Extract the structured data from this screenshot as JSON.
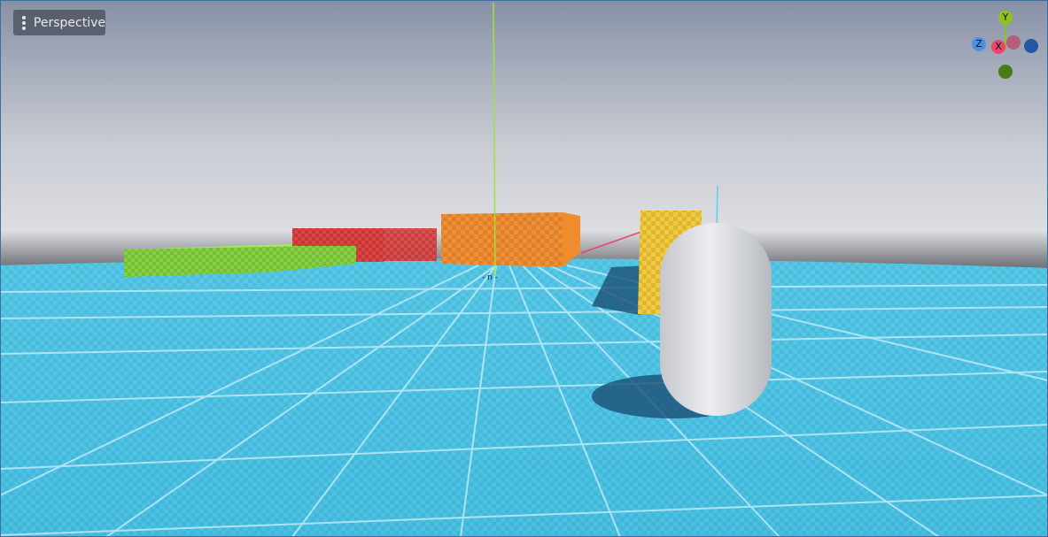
{
  "viewport": {
    "view_menu_label": "Perspective",
    "gizmo": {
      "y_label": "Y",
      "z_label": "Z",
      "x_label": "X"
    }
  },
  "scene": {
    "sky_color": "#8e99ad",
    "floor_color": "#56c8e4",
    "floor_line_color": "#bfeaf6",
    "objects": [
      {
        "name": "green-box",
        "color": "#7fc93f"
      },
      {
        "name": "red-box",
        "color": "#cf3b39"
      },
      {
        "name": "orange-box",
        "color": "#e8892f"
      },
      {
        "name": "yellow-box",
        "color": "#e8c43a"
      },
      {
        "name": "white-capsule",
        "color": "#d7d9de"
      }
    ]
  }
}
